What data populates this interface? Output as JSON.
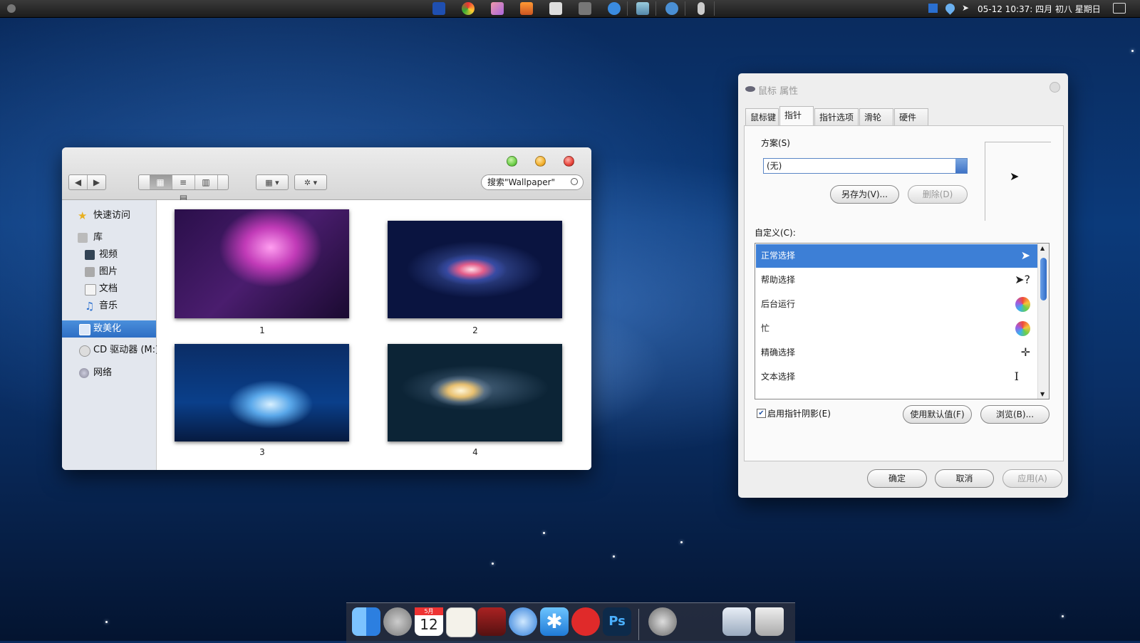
{
  "menubar": {
    "clock": "05-12  10:37: 四月 初八 星期日",
    "tray_icons": [
      "fx-icon",
      "chrome-icon",
      "photo-icon",
      "folder-icon",
      "notes-icon",
      "tools-icon",
      "browser-icon",
      "finder-icon",
      "globe-icon",
      "mouse-icon"
    ],
    "right_icons": [
      "plus-icon",
      "drop-icon",
      "send-icon",
      "notification-icon"
    ]
  },
  "explorer": {
    "search_placeholder": "搜索\"Wallpaper\"",
    "view_buttons": [
      "▦",
      "≡",
      "▥",
      "▤"
    ],
    "nav_back": "◀",
    "nav_forward": "▶",
    "arrange_button": "▦ ▾",
    "action_button": "✲ ▾",
    "sidebar": {
      "quick_access": "快速访问",
      "library": "库",
      "videos": "视频",
      "pictures": "图片",
      "documents": "文档",
      "music": "音乐",
      "personalize": "致美化",
      "cd_drive": "CD 驱动器 (M:)",
      "network": "网络"
    },
    "items": [
      {
        "label": "1"
      },
      {
        "label": "2"
      },
      {
        "label": "3"
      },
      {
        "label": "4"
      }
    ]
  },
  "dialog": {
    "title": "鼠标 属性",
    "tabs": [
      "鼠标键",
      "指针",
      "指针选项",
      "滑轮",
      "硬件"
    ],
    "active_tab": "指针",
    "scheme_label": "方案(S)",
    "scheme_value": "(无)",
    "save_as_button": "另存为(V)...",
    "delete_button": "删除(D)",
    "customize_label": "自定义(C):",
    "cursors": [
      {
        "name": "正常选择",
        "glyph": "➤"
      },
      {
        "name": "帮助选择",
        "glyph": "➤?"
      },
      {
        "name": "后台运行",
        "glyph": "wheel"
      },
      {
        "name": "忙",
        "glyph": "wheel"
      },
      {
        "name": "精确选择",
        "glyph": "✛"
      },
      {
        "name": "文本选择",
        "glyph": "I"
      }
    ],
    "enable_shadow_label": "启用指针阴影(E)",
    "enable_shadow_checked": true,
    "use_default_button": "使用默认值(F)",
    "browse_button": "浏览(B)...",
    "ok_button": "确定",
    "cancel_button": "取消",
    "apply_button": "应用(A)"
  },
  "dock": {
    "apps": [
      "finder-icon",
      "launchpad-icon",
      "calendar-icon",
      "textedit-icon",
      "photo-booth-icon",
      "safari-icon",
      "app-store-icon",
      "netease-music-icon",
      "photoshop-icon",
      "automator-icon",
      "screenshot-icon",
      "trash-icon"
    ],
    "calendar_day": "12",
    "calendar_month": "5月"
  },
  "colors": {
    "selection": "#3d7fd6",
    "sidebar_selection": "#2e6ec4",
    "traffic_green": "#6fcf4a",
    "traffic_yellow": "#f2b02e",
    "traffic_red": "#e8453c"
  }
}
